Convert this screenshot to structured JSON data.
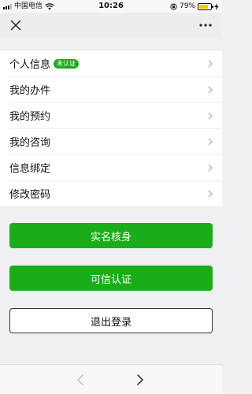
{
  "status_bar": {
    "carrier": "中国电信",
    "time": "10:26",
    "battery": "79%",
    "battery_level": 0.79
  },
  "nav": {
    "close_icon": "close-icon",
    "more_icon": "more-icon"
  },
  "menu": {
    "items": [
      {
        "label": "个人信息",
        "badge": "未认证"
      },
      {
        "label": "我的办件"
      },
      {
        "label": "我的预约"
      },
      {
        "label": "我的咨询"
      },
      {
        "label": "信息绑定"
      },
      {
        "label": "修改密码"
      }
    ]
  },
  "buttons": {
    "real_name": "实名核身",
    "trusted_auth": "可信认证",
    "logout": "退出登录"
  },
  "colors": {
    "accent": "#1aad19",
    "badge": "#1aad19",
    "battery": "#f5c518"
  }
}
